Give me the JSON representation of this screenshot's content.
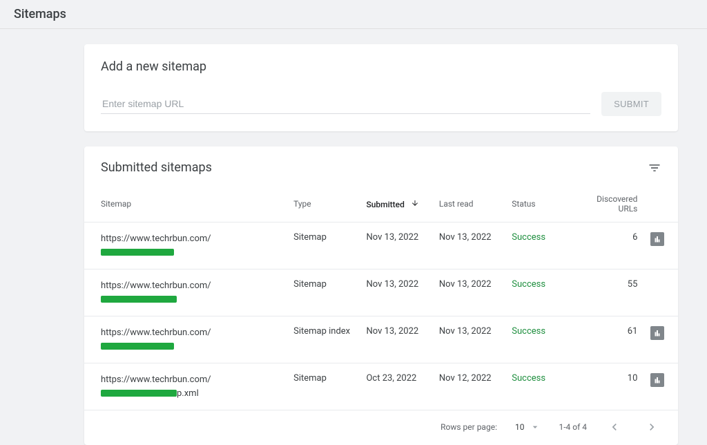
{
  "pageTitle": "Sitemaps",
  "addSection": {
    "title": "Add a new sitemap",
    "placeholder": "Enter sitemap URL",
    "submitLabel": "SUBMIT"
  },
  "listSection": {
    "title": "Submitted sitemaps",
    "columns": {
      "sitemap": "Sitemap",
      "type": "Type",
      "submitted": "Submitted",
      "lastRead": "Last read",
      "status": "Status",
      "discovered": "Discovered URLs"
    },
    "rows": [
      {
        "urlPrefix": "https://www.techrbun.com/",
        "urlSuffix": "",
        "type": "Sitemap",
        "submitted": "Nov 13, 2022",
        "lastRead": "Nov 13, 2022",
        "status": "Success",
        "discovered": "6",
        "hasChart": true
      },
      {
        "urlPrefix": "https://www.techrbun.com/",
        "urlSuffix": "",
        "type": "Sitemap",
        "submitted": "Nov 13, 2022",
        "lastRead": "Nov 13, 2022",
        "status": "Success",
        "discovered": "55",
        "hasChart": false
      },
      {
        "urlPrefix": "https://www.techrbun.com/",
        "urlSuffix": "",
        "type": "Sitemap index",
        "submitted": "Nov 13, 2022",
        "lastRead": "Nov 13, 2022",
        "status": "Success",
        "discovered": "61",
        "hasChart": true
      },
      {
        "urlPrefix": "https://www.techrbun.com/",
        "urlSuffix": "p.xml",
        "type": "Sitemap",
        "submitted": "Oct 23, 2022",
        "lastRead": "Nov 12, 2022",
        "status": "Success",
        "discovered": "10",
        "hasChart": true
      }
    ]
  },
  "pagination": {
    "rowsLabel": "Rows per page:",
    "rowsValue": "10",
    "rangeLabel": "1-4 of 4"
  }
}
